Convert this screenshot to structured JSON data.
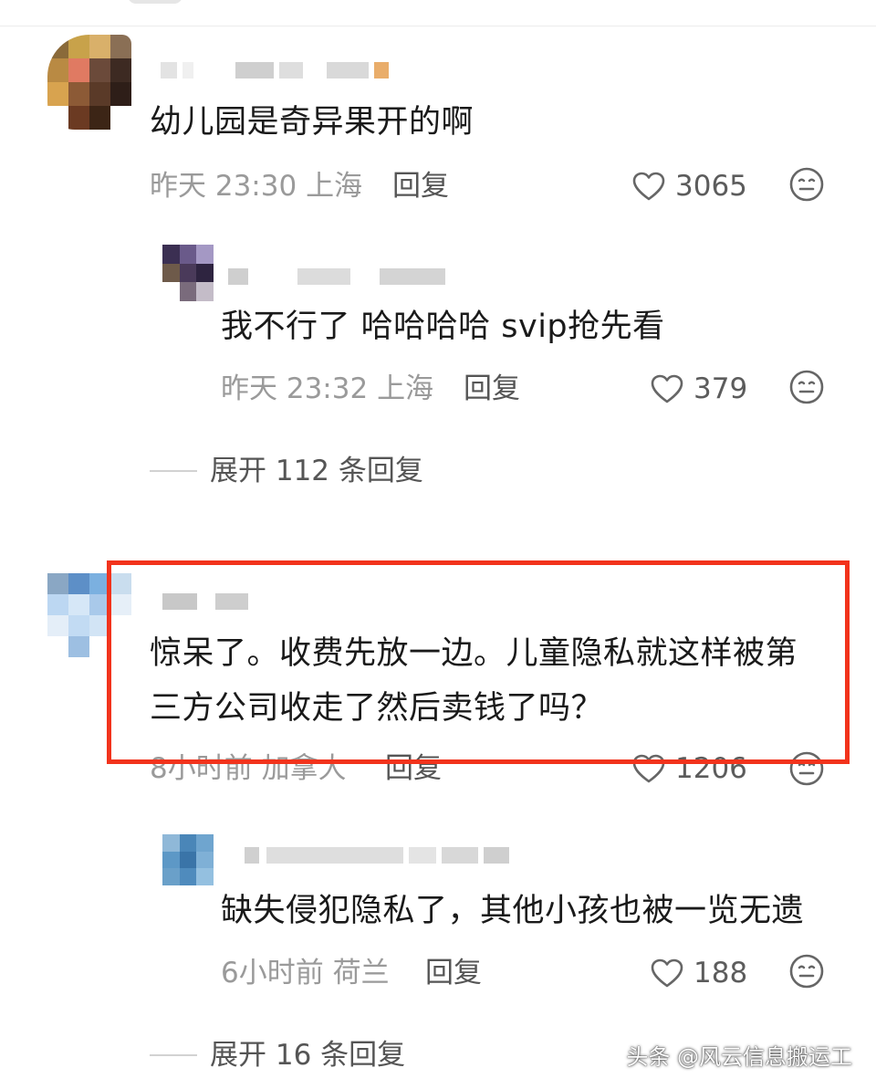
{
  "comments": [
    {
      "text": "幼儿园是奇异果开的啊",
      "time": "昨天 23:30",
      "location": "上海",
      "reply_label": "回复",
      "likes": "3065",
      "icons": [
        "heart-outline-icon",
        "emoji-face-icon"
      ]
    },
    {
      "text": "我不行了 哈哈哈哈 svip抢先看",
      "time": "昨天 23:32",
      "location": "上海",
      "reply_label": "回复",
      "likes": "379"
    },
    {
      "text_line1": "惊呆了。收费先放一边。儿童隐私就这样被第",
      "text_line2": "三方公司收走了然后卖钱了吗？",
      "time": "8小时前",
      "location": "加拿大",
      "reply_label": "回复",
      "likes": "1206"
    },
    {
      "text": "缺失侵犯隐私了，其他小孩也被一览无遗",
      "time": "6小时前",
      "location": "荷兰",
      "reply_label": "回复",
      "likes": "188"
    }
  ],
  "expand_replies": [
    "展开 112 条回复",
    "展开 16 条回复"
  ],
  "highlight_color": "#f2331c",
  "watermark": "头条 @风云信息搬运工"
}
